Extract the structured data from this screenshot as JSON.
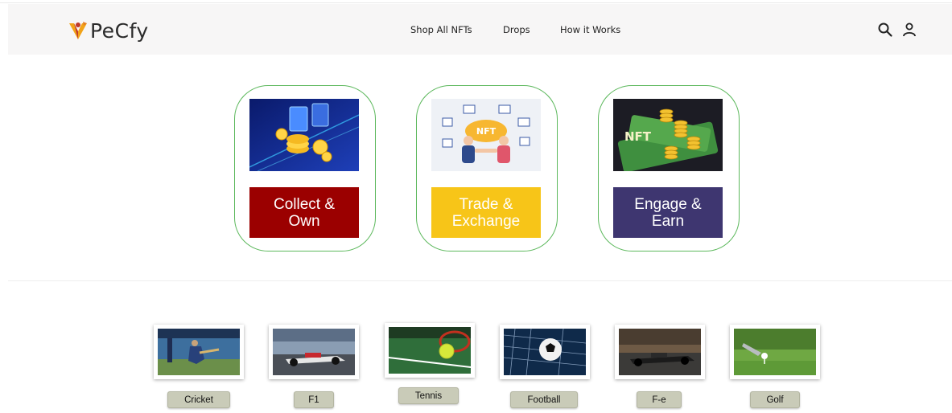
{
  "brand": {
    "name": "PeCfy",
    "accent": "#f2a319",
    "accent2": "#c0392b"
  },
  "nav": {
    "items": [
      "Shop All NFTs",
      "Drops",
      "How it Works"
    ]
  },
  "header_icons": [
    "search-icon",
    "user-icon"
  ],
  "features": [
    {
      "label_line1": "Collect &",
      "label_line2": "Own",
      "color": "#9b0000"
    },
    {
      "label_line1": "Trade &",
      "label_line2": "Exchange",
      "color": "#f7c518"
    },
    {
      "label_line1": "Engage &",
      "label_line2": "Earn",
      "color": "#3e3670"
    }
  ],
  "sports": [
    {
      "label": "Cricket"
    },
    {
      "label": "F1"
    },
    {
      "label": "Tennis"
    },
    {
      "label": "Football"
    },
    {
      "label": "F-e"
    },
    {
      "label": "Golf"
    }
  ]
}
